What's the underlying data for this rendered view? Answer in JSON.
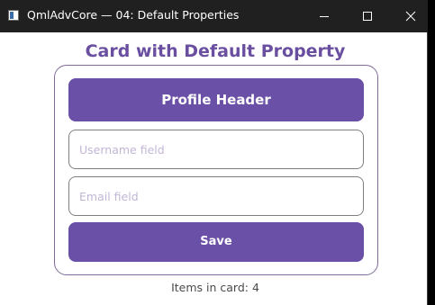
{
  "window": {
    "title": "QmlAdvCore — 04: Default Properties"
  },
  "page": {
    "title": "Card with Default Property"
  },
  "card": {
    "header_label": "Profile Header",
    "username_placeholder": "Username field",
    "username_value": "",
    "email_placeholder": "Email field",
    "email_value": "",
    "save_label": "Save"
  },
  "footer": {
    "items_count_text": "Items in card: 4"
  },
  "icons": {
    "app": "app-window-icon",
    "minimize": "minimize-icon",
    "maximize": "maximize-icon",
    "close": "close-icon"
  },
  "colors": {
    "accent": "#6a50a6",
    "title_text": "#6a4fa0",
    "titlebar": "#202020",
    "placeholder": "#c2b6d6"
  }
}
